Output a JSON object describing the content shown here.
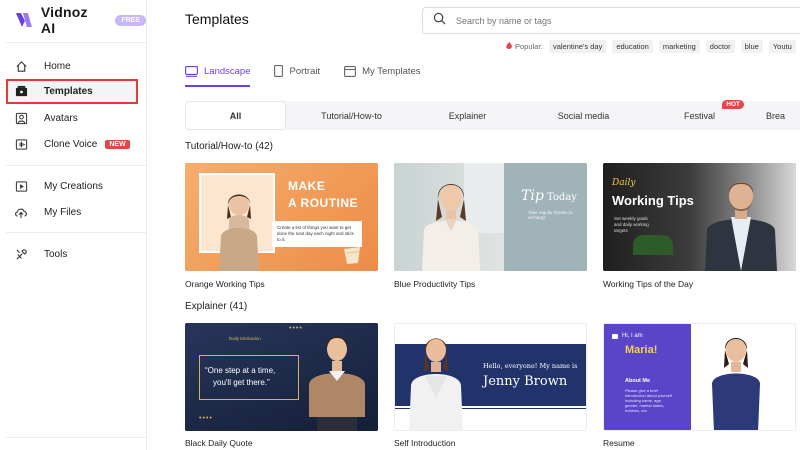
{
  "brand": {
    "name": "Vidnoz AI",
    "badge": "FREE",
    "color": "#6a3de8"
  },
  "sidebar": {
    "items": [
      {
        "label": "Home",
        "icon": "home-icon"
      },
      {
        "label": "Templates",
        "icon": "templates-icon",
        "active": true
      },
      {
        "label": "Avatars",
        "icon": "avatar-icon"
      },
      {
        "label": "Clone Voice",
        "icon": "voice-icon",
        "badge": "NEW"
      },
      {
        "label": "My Creations",
        "icon": "play-icon"
      },
      {
        "label": "My Files",
        "icon": "upload-icon"
      },
      {
        "label": "Tools",
        "icon": "tools-icon"
      }
    ]
  },
  "header": {
    "title": "Templates"
  },
  "search": {
    "placeholder": "Search by name or tags"
  },
  "popular": {
    "label": "Popular:",
    "tags": [
      "valentine's day",
      "education",
      "marketing",
      "doctor",
      "blue",
      "Youtu"
    ]
  },
  "tabs": [
    {
      "label": "Landscape",
      "active": true
    },
    {
      "label": "Portrait"
    },
    {
      "label": "My Templates"
    }
  ],
  "categories": [
    {
      "label": "All",
      "active": true
    },
    {
      "label": "Tutorial/How-to"
    },
    {
      "label": "Explainer"
    },
    {
      "label": "Social media"
    },
    {
      "label": "Festival",
      "badge": "HOT"
    },
    {
      "label": "Brea"
    }
  ],
  "sections": [
    {
      "title": "Tutorial/How-to (42)",
      "cards": [
        {
          "title": "Orange Working Tips",
          "heading1": "MAKE",
          "heading2": "A ROUTINE",
          "body": "Create a list of things you want to get done the next day each night and stick to it."
        },
        {
          "title": "Blue Productivity Tips",
          "script": "Tip",
          "heading": "Today",
          "body": "Take regular breaks to recharge"
        },
        {
          "title": "Working Tips of the Day",
          "script": "Daily",
          "heading": "Working Tips",
          "body": "Set weekly goals and daily working targets"
        }
      ]
    },
    {
      "title": "Explainer (41)",
      "cards": [
        {
          "title": "Black Daily Quote",
          "small": "Daily Motivation",
          "quote1": "“One step at a time,",
          "quote2": "you'll get there.”"
        },
        {
          "title": "Self Introduction",
          "line1": "Hello, everyone! My name is",
          "name": "Jenny Brown"
        },
        {
          "title": "Resume",
          "greet": "Hi, I am",
          "name": "Maria!",
          "sub": "About Me",
          "body": "Please give a brief introduction about yourself including name, age, gender, marital status, hobbies, etc."
        }
      ]
    }
  ]
}
